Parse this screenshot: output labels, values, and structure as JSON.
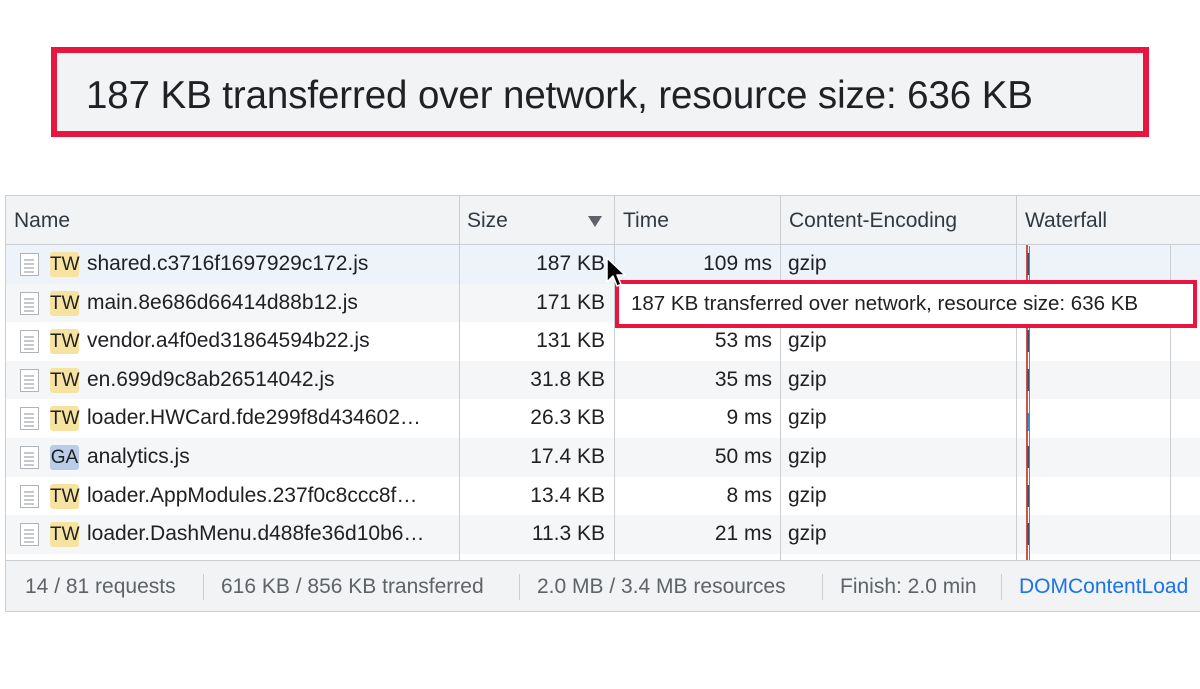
{
  "callout": {
    "text": "187 KB transferred over network, resource size: 636 KB"
  },
  "table": {
    "columns": {
      "name": "Name",
      "size": "Size",
      "time": "Time",
      "encoding": "Content-Encoding",
      "waterfall": "Waterfall"
    },
    "sort": {
      "column": "Size",
      "direction": "descending"
    },
    "rows": [
      {
        "icon": "TW",
        "name": "shared.c3716f1697929c172.js",
        "size": "187 KB",
        "time": "109 ms",
        "encoding": "gzip"
      },
      {
        "icon": "TW",
        "name": "main.8e686d66414d88b12.js",
        "size": "171 KB",
        "time": "",
        "encoding": ""
      },
      {
        "icon": "TW",
        "name": "vendor.a4f0ed31864594b22.js",
        "size": "131 KB",
        "time": "53 ms",
        "encoding": "gzip"
      },
      {
        "icon": "TW",
        "name": "en.699d9c8ab26514042.js",
        "size": "31.8 KB",
        "time": "35 ms",
        "encoding": "gzip"
      },
      {
        "icon": "TW",
        "name": "loader.HWCard.fde299f8d434602…",
        "size": "26.3 KB",
        "time": "9 ms",
        "encoding": "gzip"
      },
      {
        "icon": "GA",
        "name": "analytics.js",
        "size": "17.4 KB",
        "time": "50 ms",
        "encoding": "gzip"
      },
      {
        "icon": "TW",
        "name": "loader.AppModules.237f0c8ccc8f…",
        "size": "13.4 KB",
        "time": "8 ms",
        "encoding": "gzip"
      },
      {
        "icon": "TW",
        "name": "loader.DashMenu.d488fe36d10b6…",
        "size": "11.3 KB",
        "time": "21 ms",
        "encoding": "gzip"
      }
    ]
  },
  "tooltip": {
    "text": "187 KB transferred over network, resource size: 636 KB"
  },
  "status": {
    "requests": "14 / 81 requests",
    "transferred": "616 KB / 856 KB transferred",
    "resources": "2.0 MB / 3.4 MB resources",
    "finish": "Finish: 2.0 min",
    "dom": "DOMContentLoad"
  },
  "colors": {
    "highlight": "#e8153f",
    "tw_badge": "#f7e3a1",
    "ga_badge": "#b9cce8",
    "link": "#1a73e8"
  }
}
